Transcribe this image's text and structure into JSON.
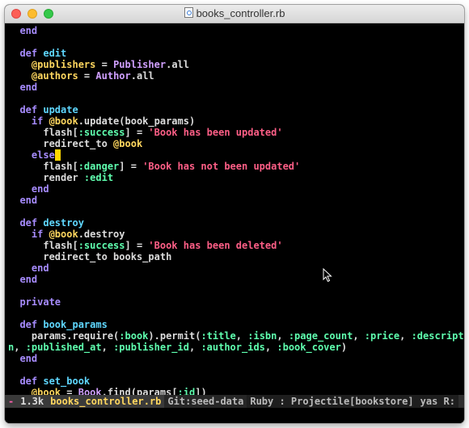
{
  "window": {
    "title": "books_controller.rb"
  },
  "code_lines": [
    [
      [
        "kw",
        "  end"
      ]
    ],
    [],
    [
      [
        "kw",
        "  def "
      ],
      [
        "fn",
        "edit"
      ]
    ],
    [
      [
        "iv",
        "    @publishers"
      ],
      [
        "tx",
        " = "
      ],
      [
        "cn",
        "Publisher"
      ],
      [
        "tx",
        ".all"
      ]
    ],
    [
      [
        "iv",
        "    @authors"
      ],
      [
        "tx",
        " = "
      ],
      [
        "cn",
        "Author"
      ],
      [
        "tx",
        ".all"
      ]
    ],
    [
      [
        "kw",
        "  end"
      ]
    ],
    [],
    [
      [
        "kw",
        "  def "
      ],
      [
        "fn",
        "update"
      ]
    ],
    [
      [
        "kw",
        "    if "
      ],
      [
        "iv",
        "@book"
      ],
      [
        "tx",
        ".update(book_params)"
      ]
    ],
    [
      [
        "tx",
        "      flash["
      ],
      [
        "sym",
        ":success"
      ],
      [
        "tx",
        "] = "
      ],
      [
        "str",
        "'Book has been updated'"
      ]
    ],
    [
      [
        "tx",
        "      redirect_to "
      ],
      [
        "iv",
        "@book"
      ]
    ],
    [
      [
        "kw",
        "    else"
      ],
      [
        "cursor",
        " "
      ]
    ],
    [
      [
        "tx",
        "      flash["
      ],
      [
        "sym",
        ":danger"
      ],
      [
        "tx",
        "] = "
      ],
      [
        "str",
        "'Book has not been updated'"
      ]
    ],
    [
      [
        "tx",
        "      render "
      ],
      [
        "sym",
        ":edit"
      ]
    ],
    [
      [
        "kw",
        "    end"
      ]
    ],
    [
      [
        "kw",
        "  end"
      ]
    ],
    [],
    [
      [
        "kw",
        "  def "
      ],
      [
        "fn",
        "destroy"
      ]
    ],
    [
      [
        "kw",
        "    if "
      ],
      [
        "iv",
        "@book"
      ],
      [
        "tx",
        ".destroy"
      ]
    ],
    [
      [
        "tx",
        "      flash["
      ],
      [
        "sym",
        ":success"
      ],
      [
        "tx",
        "] = "
      ],
      [
        "str",
        "'Book has been deleted'"
      ]
    ],
    [
      [
        "tx",
        "      redirect_to books_path"
      ]
    ],
    [
      [
        "kw",
        "    end"
      ]
    ],
    [
      [
        "kw",
        "  end"
      ]
    ],
    [],
    [
      [
        "kw",
        "  private"
      ]
    ],
    [],
    [
      [
        "kw",
        "  def "
      ],
      [
        "fn",
        "book_params"
      ]
    ],
    [
      [
        "tx",
        "    params.require("
      ],
      [
        "sym",
        ":book"
      ],
      [
        "tx",
        ").permit("
      ],
      [
        "sym",
        ":title"
      ],
      [
        "tx",
        ", "
      ],
      [
        "sym",
        ":isbn"
      ],
      [
        "tx",
        ", "
      ],
      [
        "sym",
        ":page_count"
      ],
      [
        "tx",
        ", "
      ],
      [
        "sym",
        ":price"
      ],
      [
        "tx",
        ", "
      ],
      [
        "sym",
        ":descriptio"
      ]
    ],
    [
      [
        "sym",
        "n"
      ],
      [
        "tx",
        ", "
      ],
      [
        "sym",
        ":published_at"
      ],
      [
        "tx",
        ", "
      ],
      [
        "sym",
        ":publisher_id"
      ],
      [
        "tx",
        ", "
      ],
      [
        "sym",
        ":author_ids"
      ],
      [
        "tx",
        ", "
      ],
      [
        "sym",
        ":book_cover"
      ],
      [
        "tx",
        ")"
      ]
    ],
    [
      [
        "kw",
        "  end"
      ]
    ],
    [],
    [
      [
        "kw",
        "  def "
      ],
      [
        "fn",
        "set_book"
      ]
    ],
    [
      [
        "iv",
        "    @book"
      ],
      [
        "tx",
        " = "
      ],
      [
        "cn",
        "Book"
      ],
      [
        "tx",
        ".find(params["
      ],
      [
        "sym",
        ":id"
      ],
      [
        "tx",
        "])"
      ]
    ]
  ],
  "statusbar": {
    "mode": " -",
    "size": "1.3k",
    "filename": "books_controller.rb",
    "git": "Git:seed-data",
    "major_mode": "Ruby : Projectile[bookstore]",
    "extra": "yas R:"
  },
  "colors": {
    "keyword": "#a78cff",
    "function": "#5fd7ff",
    "ivar": "#ffd75f",
    "constant": "#d0a0ff",
    "string": "#ff5f87",
    "symbol": "#5fffaf",
    "cursor": "#ffd700"
  }
}
